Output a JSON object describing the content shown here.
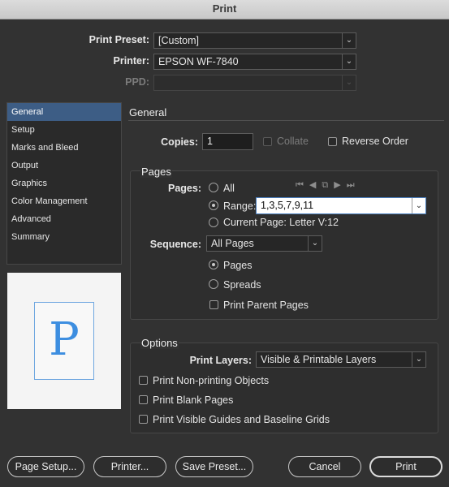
{
  "window": {
    "title": "Print"
  },
  "header": {
    "preset_label": "Print Preset:",
    "preset_value": "[Custom]",
    "printer_label": "Printer:",
    "printer_value": "EPSON WF-7840",
    "ppd_label": "PPD:",
    "ppd_value": ""
  },
  "sidebar": {
    "items": [
      {
        "label": "General",
        "active": true
      },
      {
        "label": "Setup"
      },
      {
        "label": "Marks and Bleed"
      },
      {
        "label": "Output"
      },
      {
        "label": "Graphics"
      },
      {
        "label": "Color Management"
      },
      {
        "label": "Advanced"
      },
      {
        "label": "Summary"
      }
    ]
  },
  "preview": {
    "letter": "P"
  },
  "general": {
    "title": "General",
    "copies_label": "Copies:",
    "copies_value": "1",
    "collate_label": "Collate",
    "reverse_label": "Reverse Order"
  },
  "pages": {
    "title": "Pages",
    "pages_label": "Pages:",
    "all_label": "All",
    "range_label": "Range:",
    "range_value": "1,3,5,7,9,11",
    "current_label": "Current Page: Letter V:12",
    "sequence_label": "Sequence:",
    "sequence_value": "All Pages",
    "opt_pages": "Pages",
    "opt_spreads": "Spreads",
    "print_parent": "Print Parent Pages",
    "nav_icons": [
      "first-page-icon",
      "prev-page-icon",
      "pages-icon",
      "next-page-icon",
      "last-page-icon"
    ]
  },
  "options": {
    "title": "Options",
    "layers_label": "Print Layers:",
    "layers_value": "Visible & Printable Layers",
    "nonprinting": "Print Non-printing Objects",
    "blank": "Print Blank Pages",
    "guides": "Print Visible Guides and Baseline Grids"
  },
  "buttons": {
    "page_setup": "Page Setup...",
    "printer": "Printer...",
    "save_preset": "Save Preset...",
    "cancel": "Cancel",
    "print": "Print"
  },
  "colors": {
    "accent": "#3d5d85",
    "preview_blue": "#3d8ee0",
    "background": "#323232"
  }
}
